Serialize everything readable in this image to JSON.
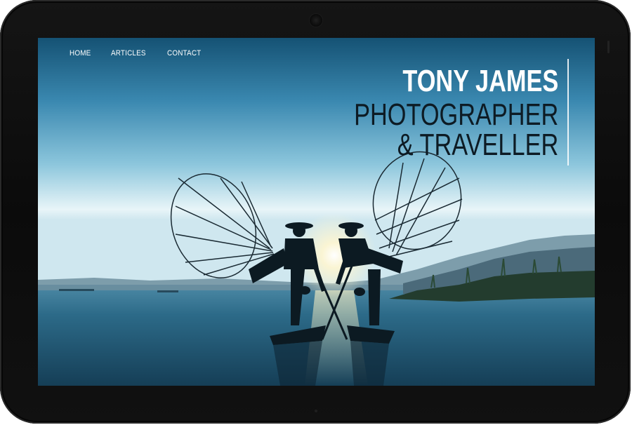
{
  "nav": {
    "items": [
      {
        "label": "HOME"
      },
      {
        "label": "ARTICLES"
      },
      {
        "label": "CONTACT"
      }
    ]
  },
  "hero": {
    "name": "TONY JAMES",
    "line1": "PHOTOGRAPHER",
    "line2": "& TRAVELLER"
  },
  "colors": {
    "device_frame": "#0b0b0b",
    "sky_top": "#1b5577",
    "sky_horizon": "#dff1f6",
    "water": "#1a4d6a",
    "title_white": "#ffffff",
    "title_dark": "#0d1b24"
  }
}
